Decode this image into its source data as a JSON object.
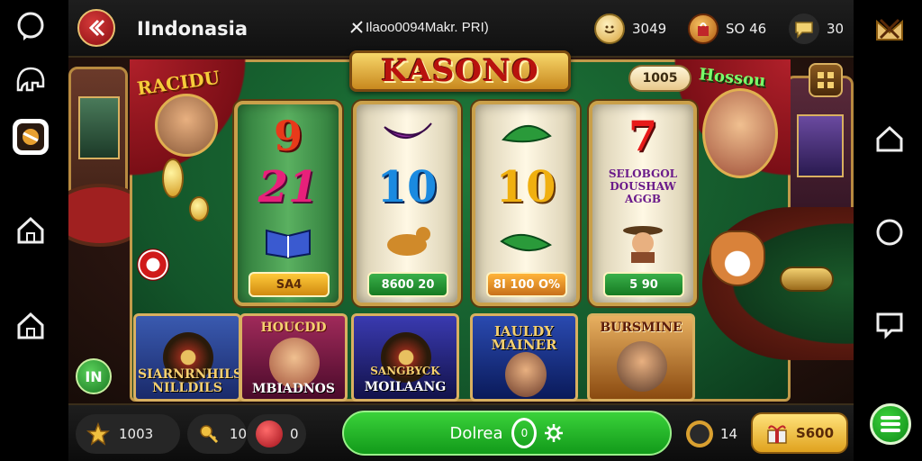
{
  "header": {
    "region_label": "IIndonasia",
    "promo_text": "Ilaoo0094Makr. PRI)",
    "stats": [
      {
        "icon": "smile-coin-icon",
        "value": "3049"
      },
      {
        "icon": "gift-bag-icon",
        "value": "SO 46"
      },
      {
        "icon": "chat-bubble-icon",
        "value": "30"
      }
    ]
  },
  "banner": {
    "title": "KASONO",
    "jackpot": "1005",
    "left_host_label": "RACIDU",
    "right_host_label": "Hossou"
  },
  "reels": [
    {
      "top": "9",
      "middle": "21",
      "bottom_icon": "book-icon",
      "payout": "SA4"
    },
    {
      "top": "~",
      "middle": "10",
      "bottom_icon": "camel-icon",
      "payout": "8600 20"
    },
    {
      "top": "~",
      "middle": "10",
      "bottom_icon": "leaf-icon",
      "payout": "8I 100 O%"
    },
    {
      "top": "7",
      "middle_text": "SELOBGOL DOUSHAW AGGB",
      "bottom_icon": "cowboy-icon",
      "payout": "5 90"
    }
  ],
  "tiles": [
    {
      "caption": "SIARNRNHILS NILLDILS"
    },
    {
      "caption_top": "HOUCDD",
      "caption_bottom": "MBIADNOS"
    },
    {
      "caption_top": "SANGBYCK",
      "caption_bottom": "MOILAANG"
    },
    {
      "caption": "IAULDY MAINER"
    },
    {
      "caption": "BURSMINE"
    }
  ],
  "side_button_label": "IN",
  "bottom": {
    "coins": "1003",
    "keys": "10",
    "gems": "0",
    "spin_label": "Dolrea",
    "spin_ring_text": "0",
    "timer_value": "14",
    "gold_button_label": "S600"
  },
  "colors": {
    "felt_green": "#1f7a3a",
    "gold_accent": "#d9b060",
    "spin_green": "#3ad23a",
    "title_red": "#b8120e"
  }
}
